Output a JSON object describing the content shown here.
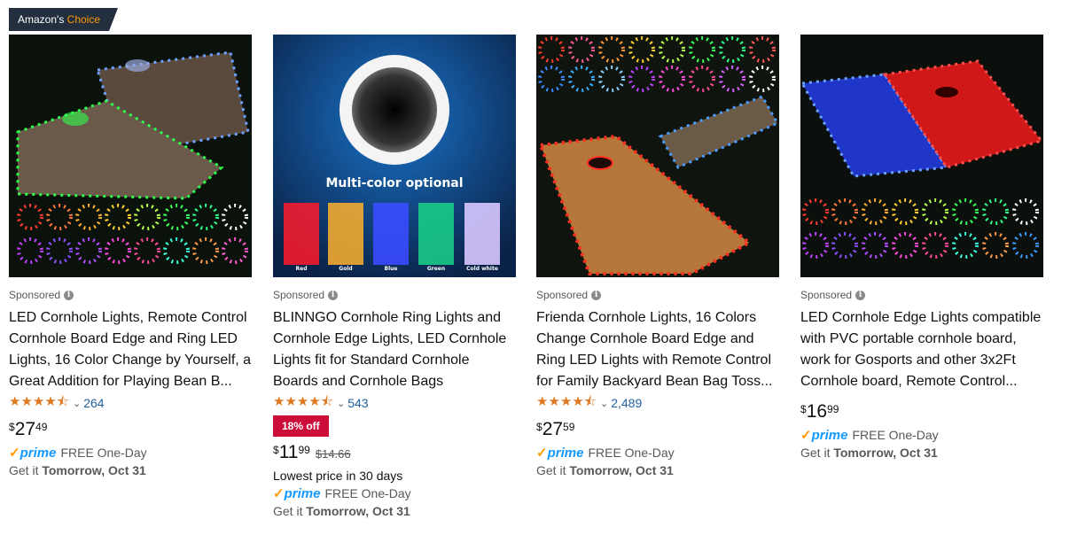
{
  "badge": {
    "prefix": "Amazon's",
    "choice": "Choice"
  },
  "sponsored_label": "Sponsored",
  "products": [
    {
      "title": "LED Cornhole Lights, Remote Control Cornhole Board Edge and Ring LED Lights, 16 Color Change by Yourself, a Great Addition for Playing Bean B...",
      "stars": "★★★★⯪",
      "rating_count": "264",
      "price_symbol": "$",
      "price_whole": "27",
      "price_fraction": "49",
      "prime": "prime",
      "shipping": "FREE One-Day",
      "delivery_prefix": "Get it",
      "delivery_date": "Tomorrow, Oct 31"
    },
    {
      "title": "BLINNGO Cornhole Ring Lights and Cornhole Edge Lights, LED Cornhole Lights fit for Standard Cornhole Boards and Cornhole Bags",
      "stars": "★★★★⯪",
      "rating_count": "543",
      "discount": "18% off",
      "price_symbol": "$",
      "price_whole": "11",
      "price_fraction": "99",
      "was_price": "$14.66",
      "lowest_price_note": "Lowest price in 30 days",
      "prime": "prime",
      "shipping": "FREE One-Day",
      "delivery_prefix": "Get it",
      "delivery_date": "Tomorrow, Oct 31",
      "image_text": "Multi-color optional",
      "swatches": [
        "Red",
        "Gold",
        "Blue",
        "Green",
        "Cold white"
      ]
    },
    {
      "title": "Frienda Cornhole Lights, 16 Colors Change Cornhole Board Edge and Ring LED Lights with Remote Control for Family Backyard Bean Bag Toss...",
      "stars": "★★★★⯪",
      "rating_count": "2,489",
      "price_symbol": "$",
      "price_whole": "27",
      "price_fraction": "59",
      "prime": "prime",
      "shipping": "FREE One-Day",
      "delivery_prefix": "Get it",
      "delivery_date": "Tomorrow, Oct 31"
    },
    {
      "title": "LED Cornhole Edge Lights compatible with PVC portable cornhole board, work for Gosports and other 3x2Ft Cornhole board, Remote Control...",
      "price_symbol": "$",
      "price_whole": "16",
      "price_fraction": "99",
      "prime": "prime",
      "shipping": "FREE One-Day",
      "delivery_prefix": "Get it",
      "delivery_date": "Tomorrow, Oct 31"
    }
  ],
  "colors": {
    "star": "#DE7921",
    "link": "#2162A1",
    "prime_blue": "#1399FF",
    "prime_check": "#FF9900",
    "discount_bg": "#CC0C39",
    "badge_bg": "#232F3E"
  }
}
